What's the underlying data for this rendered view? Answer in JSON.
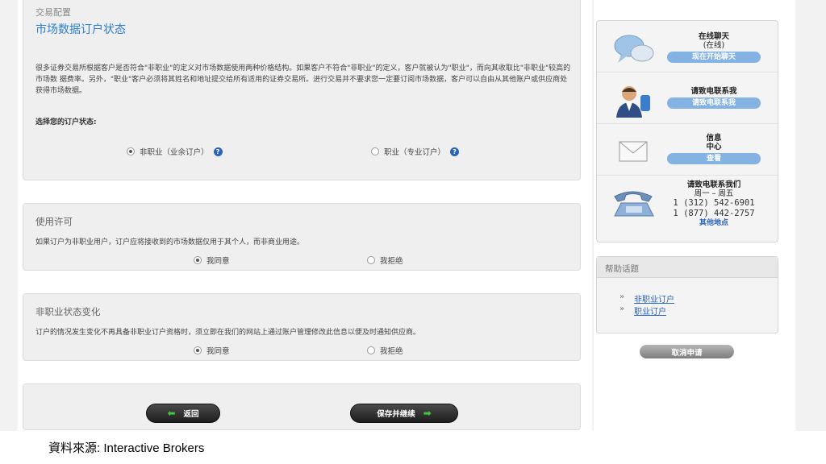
{
  "main": {
    "breadcrumb": "交易配置",
    "page_title": "市场数据订户状态",
    "intro_paragraph": "很多证券交易所根据客户是否符合\"非职业\"的定义对市场数据使用两种价格结构。如果客户不符合\"非职业\"的定义，客户就被认为\"职业\"，而向其收取比\"非职业\"较高的市场数 据费率。另外，\"职业\"客户必须将其姓名和地址提交给所有适用的证券交易所。进行交易并不要求您一定要订阅市场数据，客户可以自由从其他账户或供应商处获得市场数据。",
    "status_label": "选择您的订户状态:",
    "status_options": [
      {
        "label": "非职业（业余订户）",
        "selected": true
      },
      {
        "label": "职业（专业订户）",
        "selected": false
      }
    ],
    "license": {
      "title": "使用许可",
      "text": "如果订户为非职业用户，订户应将接收到的市场数据仅用于其个人，而非商业用途。",
      "agree": "我同意",
      "reject": "我拒绝",
      "agree_selected": true
    },
    "change": {
      "title": "非职业状态变化",
      "text": "订户的情况发生变化不再具备非职业订户资格时，须立即在我们的网站上通过账户管理修改此信息以便及时通知供应商。",
      "agree": "我同意",
      "reject": "我拒绝",
      "agree_selected": true
    },
    "buttons": {
      "back": "返回",
      "save_continue": "保存并继续"
    }
  },
  "sidebar": {
    "chat": {
      "title": "在线聊天",
      "status": "(在线)",
      "button": "现在开始聊天"
    },
    "call": {
      "title": "请致电联系我",
      "button": "请致电联系我"
    },
    "message": {
      "title_line1": "信息",
      "title_line2": "中心",
      "button": "查看"
    },
    "phone": {
      "title": "请致电联系我们",
      "hours": "周一 – 周五",
      "numbers": [
        "1 (312) 542-6901",
        "1 (877) 442-2757"
      ],
      "other": "其他地点"
    },
    "help": {
      "title": "帮助话题",
      "links": [
        "非职业订户",
        "职业订户"
      ]
    },
    "cancel_button": "取消申请"
  },
  "source_caption": "資料來源: Interactive Brokers",
  "colors": {
    "title_blue": "#2b7fd0",
    "pill_blue": "#84b3e3",
    "arrow_green": "#3cc83c"
  }
}
